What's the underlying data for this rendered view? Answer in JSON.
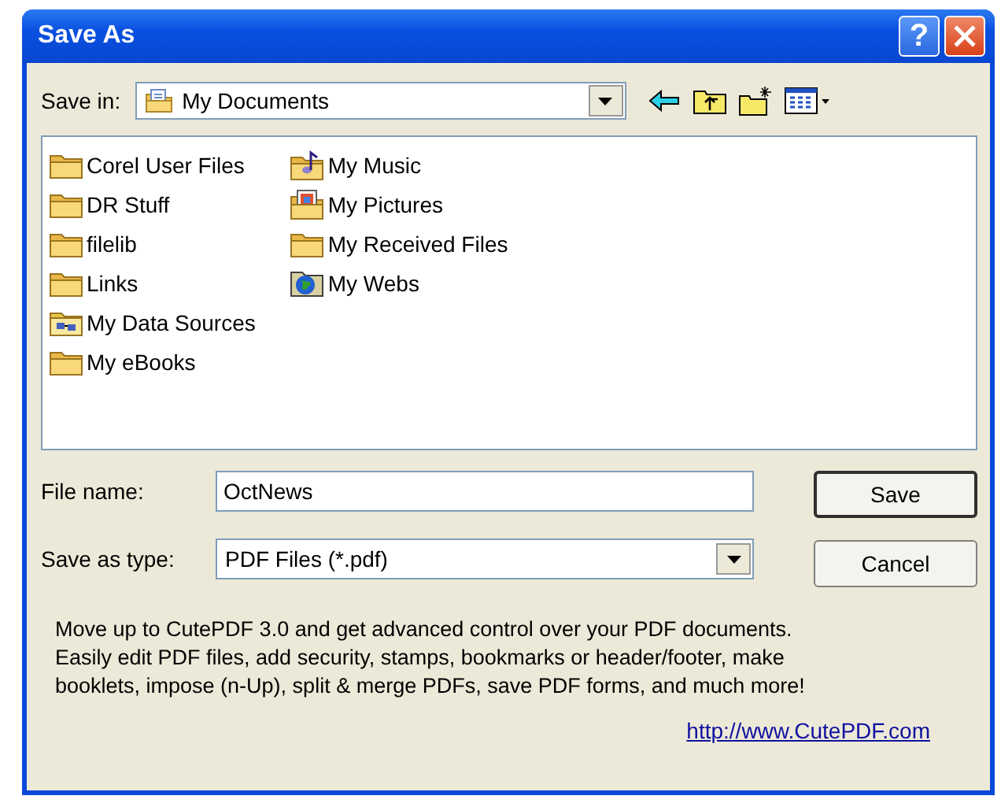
{
  "window": {
    "title": "Save As",
    "buttons": [
      "?"
    ]
  },
  "save_in": {
    "label": "Save in:",
    "value": "My Documents"
  },
  "files": [
    {
      "name": "Corel User Files",
      "kind": "folder"
    },
    {
      "name": "DR Stuff",
      "kind": "folder"
    },
    {
      "name": "filelib",
      "kind": "folder"
    },
    {
      "name": "Links",
      "kind": "folder"
    },
    {
      "name": "My Data Sources",
      "kind": "data"
    },
    {
      "name": "My eBooks",
      "kind": "folder"
    },
    {
      "name": "My Music",
      "kind": "music"
    },
    {
      "name": "My Pictures",
      "kind": "pictures"
    },
    {
      "name": "My Received Files",
      "kind": "folder"
    },
    {
      "name": "My Webs",
      "kind": "web"
    }
  ],
  "file_name": {
    "label": "File name:",
    "value": "OctNews"
  },
  "save_as_type": {
    "label": "Save as type:",
    "value": "PDF Files (*.pdf)"
  },
  "buttons": [
    {
      "label": "Save",
      "default": true
    },
    {
      "label": "Cancel",
      "default": false
    }
  ],
  "message_lines": [
    "Move up to CutePDF 3.0 and get advanced control over your PDF documents.",
    "Easily edit PDF files, add security, stamps, bookmarks or header/footer, make",
    "booklets, impose (n-Up), split & merge PDFs, save PDF forms, and much more!"
  ],
  "link": "http://www.CutePDF.com"
}
